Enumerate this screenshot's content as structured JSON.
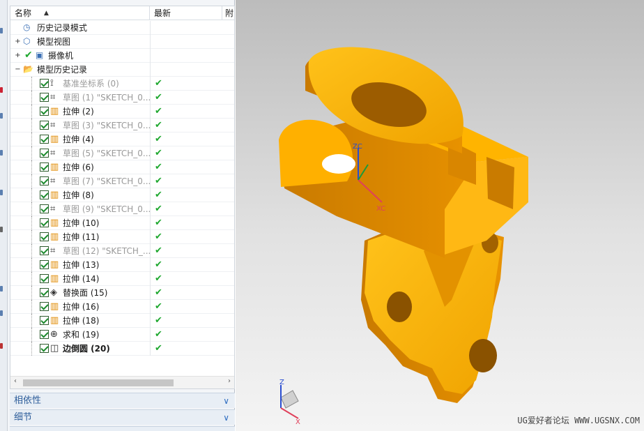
{
  "tree": {
    "headers": {
      "name": "名称",
      "latest": "最新",
      "extra": "附"
    },
    "rows": [
      {
        "label": "历史记录模式",
        "level": 0
      },
      {
        "label": "模型视图",
        "level": 0
      },
      {
        "label": "摄像机",
        "level": 0
      },
      {
        "label": "模型历史记录",
        "level": 0
      },
      {
        "label": "基准坐标系 (0)",
        "dim": true,
        "ok": "✔"
      },
      {
        "label": "草图 (1) \"SKETCH_0...",
        "dim": true,
        "ok": "✔"
      },
      {
        "label": "拉伸 (2)",
        "ok": "✔"
      },
      {
        "label": "草图 (3) \"SKETCH_0...",
        "dim": true,
        "ok": "✔"
      },
      {
        "label": "拉伸 (4)",
        "ok": "✔"
      },
      {
        "label": "草图 (5) \"SKETCH_0...",
        "dim": true,
        "ok": "✔"
      },
      {
        "label": "拉伸 (6)",
        "ok": "✔"
      },
      {
        "label": "草图 (7) \"SKETCH_0...",
        "dim": true,
        "ok": "✔"
      },
      {
        "label": "拉伸 (8)",
        "ok": "✔"
      },
      {
        "label": "草图 (9) \"SKETCH_0...",
        "dim": true,
        "ok": "✔"
      },
      {
        "label": "拉伸 (10)",
        "ok": "✔"
      },
      {
        "label": "拉伸 (11)",
        "ok": "✔"
      },
      {
        "label": "草图 (12) \"SKETCH_...",
        "dim": true,
        "ok": "✔"
      },
      {
        "label": "拉伸 (13)",
        "ok": "✔"
      },
      {
        "label": "拉伸 (14)",
        "ok": "✔"
      },
      {
        "label": "替换面 (15)",
        "ok": "✔"
      },
      {
        "label": "拉伸 (16)",
        "ok": "✔"
      },
      {
        "label": "拉伸 (18)",
        "ok": "✔"
      },
      {
        "label": "求和 (19)",
        "ok": "✔"
      },
      {
        "label": "边倒圆 (20)",
        "bold": true,
        "ok": "✔"
      }
    ]
  },
  "panels": {
    "dependencies": "相依性",
    "details": "细节"
  },
  "viewport": {
    "watermark": "UG爱好者论坛 WWW.UGSNX.COM",
    "axis_labels": {
      "zc": "ZC",
      "xc": "XC",
      "z": "Z",
      "x": "X"
    },
    "part_color": "#f2a800"
  }
}
